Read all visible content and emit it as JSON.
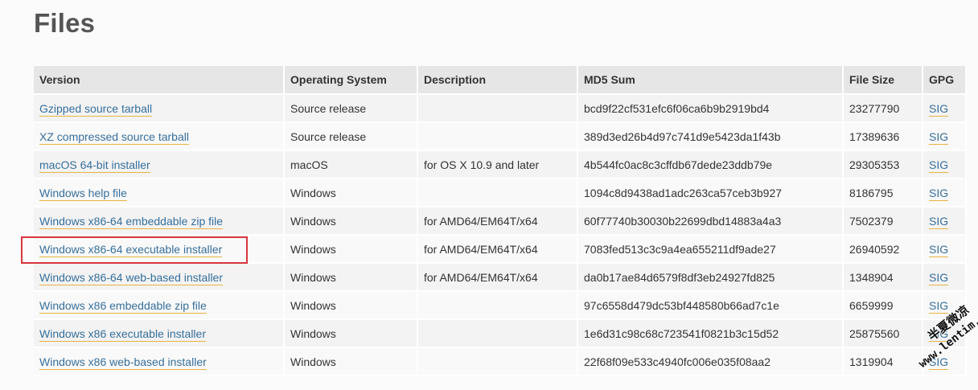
{
  "page": {
    "title": "Files"
  },
  "table": {
    "headers": [
      "Version",
      "Operating System",
      "Description",
      "MD5 Sum",
      "File Size",
      "GPG"
    ],
    "rows": [
      {
        "version": "Gzipped source tarball",
        "os": "Source release",
        "description": "",
        "md5": "bcd9f22cf531efc6f06ca6b9b2919bd4",
        "size": "23277790",
        "gpg": "SIG"
      },
      {
        "version": "XZ compressed source tarball",
        "os": "Source release",
        "description": "",
        "md5": "389d3ed26b4d97c741d9e5423da1f43b",
        "size": "17389636",
        "gpg": "SIG"
      },
      {
        "version": "macOS 64-bit installer",
        "os": "macOS",
        "description": "for OS X 10.9 and later",
        "md5": "4b544fc0ac8c3cffdb67dede23ddb79e",
        "size": "29305353",
        "gpg": "SIG"
      },
      {
        "version": "Windows help file",
        "os": "Windows",
        "description": "",
        "md5": "1094c8d9438ad1adc263ca57ceb3b927",
        "size": "8186795",
        "gpg": "SIG"
      },
      {
        "version": "Windows x86-64 embeddable zip file",
        "os": "Windows",
        "description": "for AMD64/EM64T/x64",
        "md5": "60f77740b30030b22699dbd14883a4a3",
        "size": "7502379",
        "gpg": "SIG"
      },
      {
        "version": "Windows x86-64 executable installer",
        "os": "Windows",
        "description": "for AMD64/EM64T/x64",
        "md5": "7083fed513c3c9a4ea655211df9ade27",
        "size": "26940592",
        "gpg": "SIG"
      },
      {
        "version": "Windows x86-64 web-based installer",
        "os": "Windows",
        "description": "for AMD64/EM64T/x64",
        "md5": "da0b17ae84d6579f8df3eb24927fd825",
        "size": "1348904",
        "gpg": "SIG"
      },
      {
        "version": "Windows x86 embeddable zip file",
        "os": "Windows",
        "description": "",
        "md5": "97c6558d479dc53bf448580b66ad7c1e",
        "size": "6659999",
        "gpg": "SIG"
      },
      {
        "version": "Windows x86 executable installer",
        "os": "Windows",
        "description": "",
        "md5": "1e6d31c98c68c723541f0821b3c15d52",
        "size": "25875560",
        "gpg": "SIG"
      },
      {
        "version": "Windows x86 web-based installer",
        "os": "Windows",
        "description": "",
        "md5": "22f68f09e533c4940fc006e035f08aa2",
        "size": "1319904",
        "gpg": "SIG"
      }
    ]
  },
  "annotation": {
    "highlight_color": "#d9363e"
  },
  "watermark": {
    "line1": "半夏微凉",
    "line2": "www.lentim.com"
  },
  "colors": {
    "link": "#366f9c",
    "link_underline": "#e8b340",
    "header_bg": "#e6e6e6"
  }
}
